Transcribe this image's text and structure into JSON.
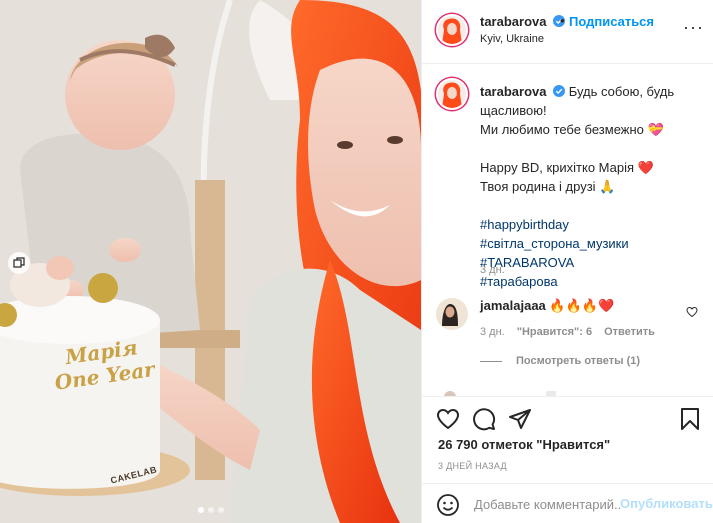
{
  "photo": {
    "cake_text_line1": "Марія",
    "cake_text_line2": "One Year",
    "cake_brand": "CAKELAB",
    "carousel_dots": 3,
    "active_dot": 1
  },
  "header": {
    "username": "tarabarova",
    "separator": "•",
    "follow_label": "Подписаться",
    "location": "Kyiv, Ukraine",
    "more_label": "···"
  },
  "caption": {
    "username": "tarabarova",
    "lines": [
      "Будь собою, будь щасливою!",
      "Ми любимо тебе безмежно 💝",
      "",
      "Happy BD, крихітко Марія ❤️",
      "Твоя родина і друзі 🙏"
    ],
    "hashtags": [
      "#happybirthday",
      "#світла_сторона_музики",
      "#TARABAROVA",
      "#тарабарова"
    ],
    "time": "3 дн."
  },
  "comment": {
    "username": "jamalajaaa",
    "text": "🔥🔥🔥❤️",
    "time": "3 дн.",
    "likes_label": "\"Нравится\": 6",
    "reply_label": "Ответить",
    "view_replies": "Посмотреть ответы (1)"
  },
  "actions": {
    "icons": [
      "heart-icon",
      "comment-icon",
      "share-icon",
      "bookmark-icon"
    ],
    "likes_text": "26 790 отметок \"Нравится\"",
    "time_ago": "3 ДНЕЙ НАЗАД"
  },
  "add_comment": {
    "placeholder": "Добавьте комментарий...",
    "post_label": "Опубликовать"
  },
  "colors": {
    "link_blue": "#0095f6",
    "hashtag": "#00376b",
    "muted": "#8e8e8e",
    "hair": "#ff4a1c"
  }
}
